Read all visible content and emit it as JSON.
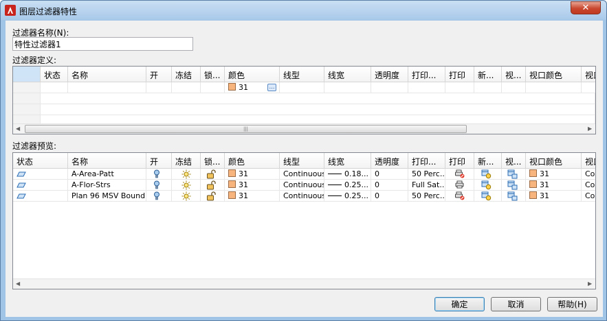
{
  "window": {
    "title": "图层过滤器特性",
    "close_glyph": "✕"
  },
  "name_section": {
    "label": "过滤器名称(N):",
    "value": "特性过滤器1"
  },
  "definition": {
    "label": "过滤器定义:",
    "columns": [
      "",
      "状态",
      "名称",
      "开",
      "冻结",
      "锁...",
      "颜色",
      "线型",
      "线宽",
      "透明度",
      "打印...",
      "打印",
      "新...",
      "视...",
      "视口颜色",
      "视口"
    ],
    "row": {
      "color_value": "31"
    },
    "scroll_thumb_glyph": "|||"
  },
  "preview": {
    "label": "过滤器预览:",
    "columns": [
      "状态",
      "名称",
      "开",
      "冻结",
      "锁...",
      "颜色",
      "线型",
      "线宽",
      "透明度",
      "打印...",
      "打印",
      "新...",
      "视...",
      "视口颜色",
      "视口"
    ],
    "rows": [
      {
        "name": "A-Area-Patt",
        "color": "31",
        "linetype": "Continuous",
        "lineweight": "0.18...",
        "transparency": "0",
        "plot_style": "50 Perc...",
        "vp_color": "31",
        "vp_cut": "Conti"
      },
      {
        "name": "A-Flor-Strs",
        "color": "31",
        "linetype": "Continuous",
        "lineweight": "0.25...",
        "transparency": "0",
        "plot_style": "Full Sat...",
        "vp_color": "31",
        "vp_cut": "Conti"
      },
      {
        "name": "Plan 96 MSV Bound...",
        "color": "31",
        "linetype": "Continuous",
        "lineweight": "0.25...",
        "transparency": "0",
        "plot_style": "50 Perc...",
        "vp_color": "31",
        "vp_cut": "Conti"
      }
    ],
    "scroll_thumb_glyph": ""
  },
  "buttons": {
    "ok": "确定",
    "cancel": "取消",
    "help": "帮助(H)"
  },
  "colors": {
    "layer_swatch": "#f7b47c",
    "title_bar": "#a9c9ea"
  }
}
